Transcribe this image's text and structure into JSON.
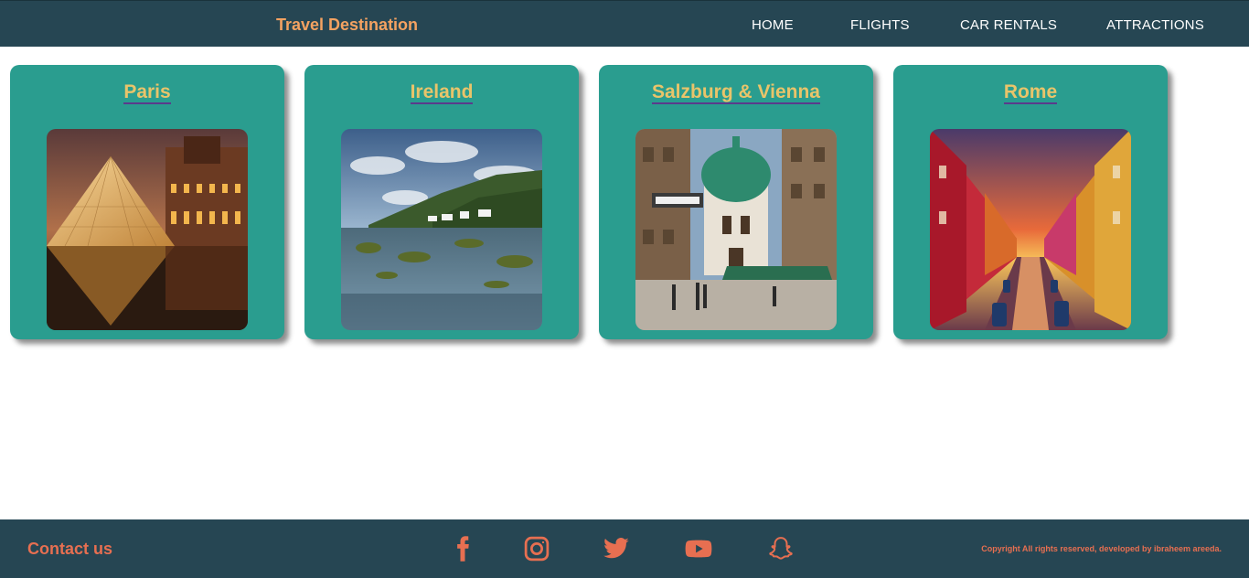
{
  "header": {
    "brand": "Travel Destination",
    "nav": [
      "HOME",
      "FLIGHTS",
      "CAR RENTALS",
      "ATTRACTIONS"
    ]
  },
  "cards": [
    {
      "title": "Paris",
      "image": "louvre-pyramid-night"
    },
    {
      "title": "Ireland",
      "image": "irish-coast-landscape"
    },
    {
      "title": "Salzburg & Vienna",
      "image": "vienna-street-church-dome"
    },
    {
      "title": "Rome",
      "image": "colorful-canal-sunset"
    }
  ],
  "footer": {
    "contact": "Contact us",
    "social_icons": [
      "facebook-icon",
      "instagram-icon",
      "twitter-icon",
      "youtube-icon",
      "snapchat-icon"
    ],
    "copyright": "Copyright All rights reserved, developed by ibraheem areeda."
  },
  "colors": {
    "header_bg": "#264653",
    "brand": "#f4a261",
    "card_bg": "#2a9d8f",
    "card_title": "#e9c46a",
    "footer_accent": "#e76f51"
  }
}
